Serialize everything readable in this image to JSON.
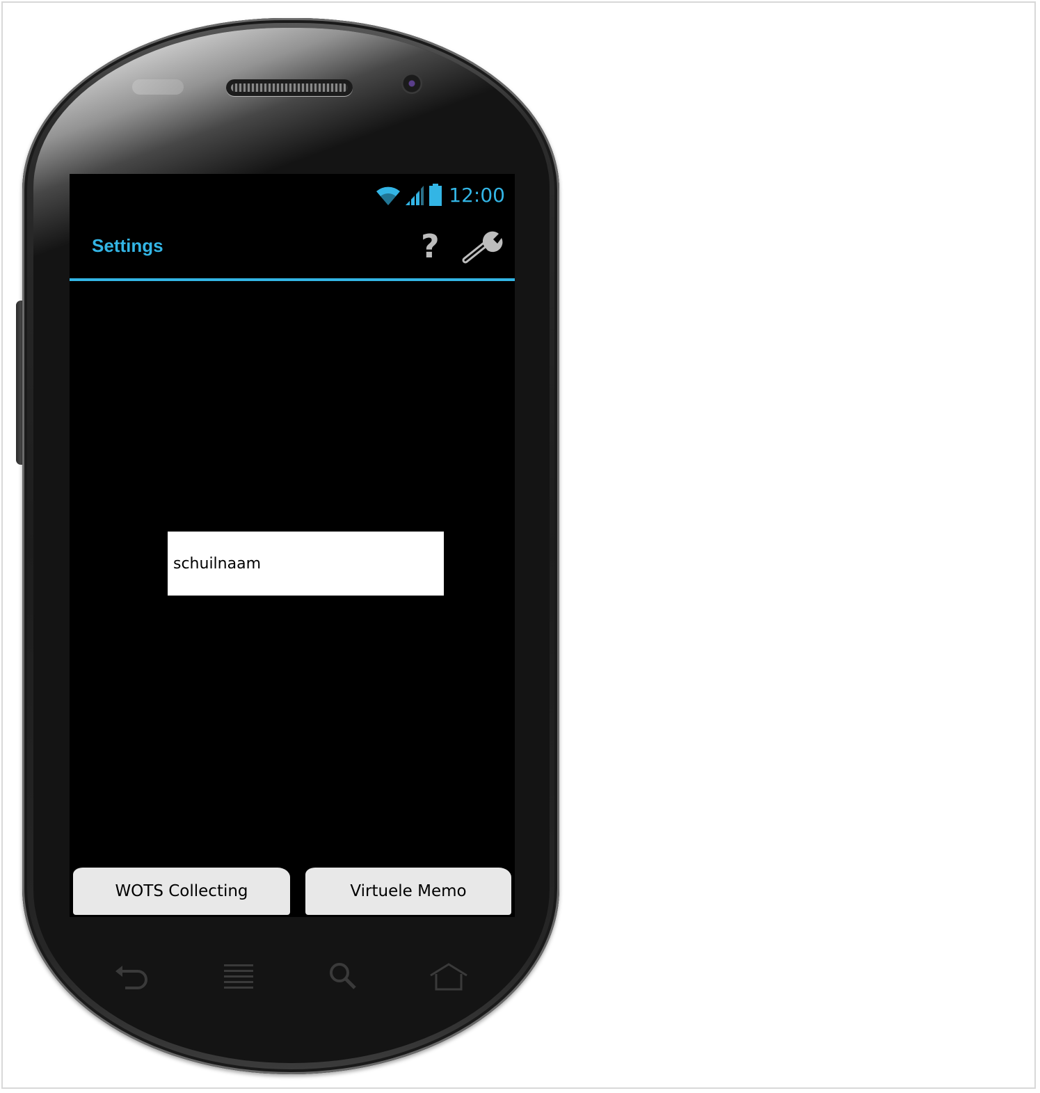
{
  "statusbar": {
    "time": "12:00",
    "icons": [
      "wifi-icon",
      "signal-icon",
      "battery-icon"
    ]
  },
  "actionbar": {
    "title": "Settings",
    "actions": [
      "help-icon",
      "settings-wrench-icon"
    ]
  },
  "main": {
    "name_field": {
      "value": "schuilnaam"
    }
  },
  "bottom_buttons": {
    "wots_label": "WOTS Collecting",
    "memo_label": "Virtuele Memo"
  },
  "navbar": {
    "keys": [
      "back-icon",
      "menu-icon",
      "search-icon",
      "home-icon"
    ]
  },
  "colors": {
    "accent": "#33b5e5",
    "screen_background": "#000000",
    "button_background": "#e8e8e8"
  }
}
